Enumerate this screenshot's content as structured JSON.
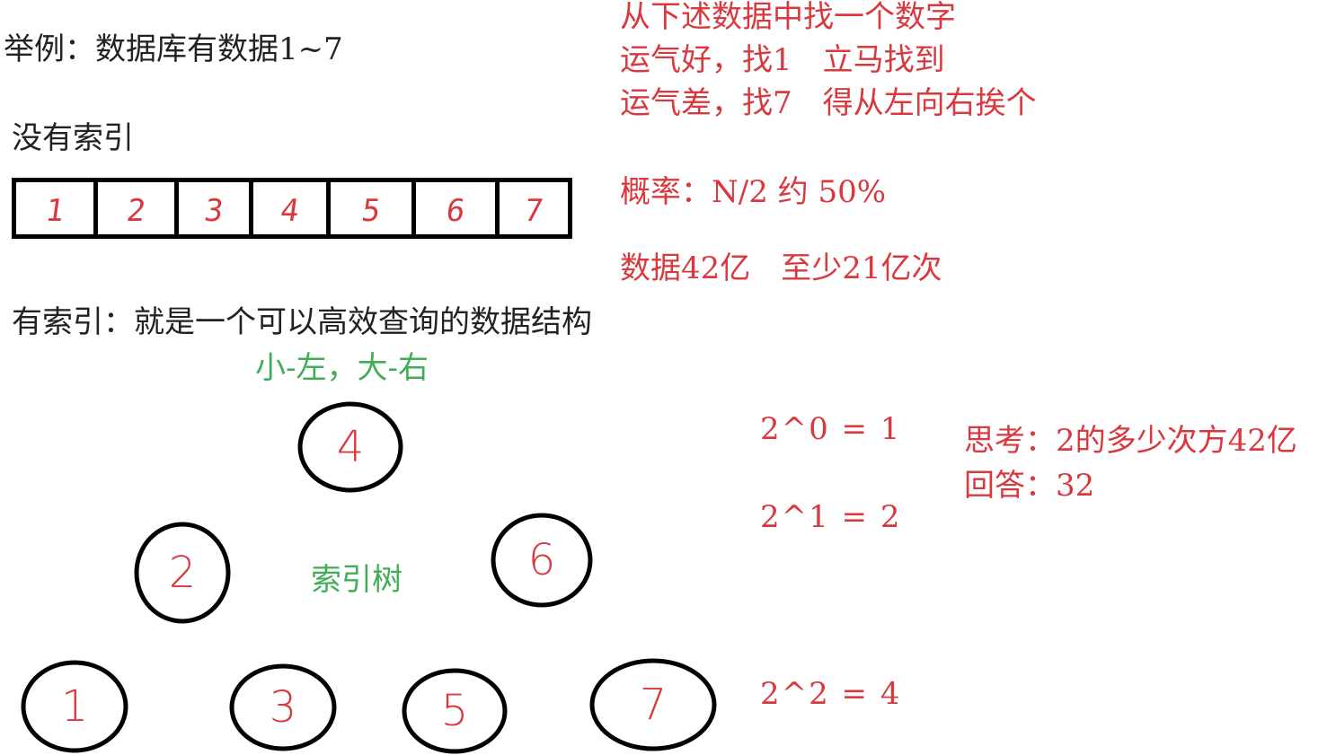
{
  "example_title": "举例：数据库有数据1~7",
  "no_index_label": "没有索引",
  "array_values": [
    "1",
    "2",
    "3",
    "4",
    "5",
    "6",
    "7"
  ],
  "search_notes": {
    "line1": "从下述数据中找一个数字",
    "line2": "运气好，找1　立马找到",
    "line3": "运气差，找7　得从左向右挨个"
  },
  "probability": "概率：N/2 约 50%",
  "data_count": "数据42亿　至少21亿次",
  "with_index_label": "有索引：就是一个可以高效查询的数据结构",
  "rule_label": "小-左，大-右",
  "tree_label": "索引树",
  "tree_nodes": [
    "4",
    "2",
    "6",
    "1",
    "3",
    "5",
    "7"
  ],
  "powers": [
    "2^0 = 1",
    "2^1 = 2",
    "2^2 = 4"
  ],
  "thinking": {
    "question": "思考：2的多少次方42亿",
    "answer": "回答：32"
  },
  "colors": {
    "ink": "#000000",
    "red": "#d9383e",
    "green": "#3fae57"
  }
}
